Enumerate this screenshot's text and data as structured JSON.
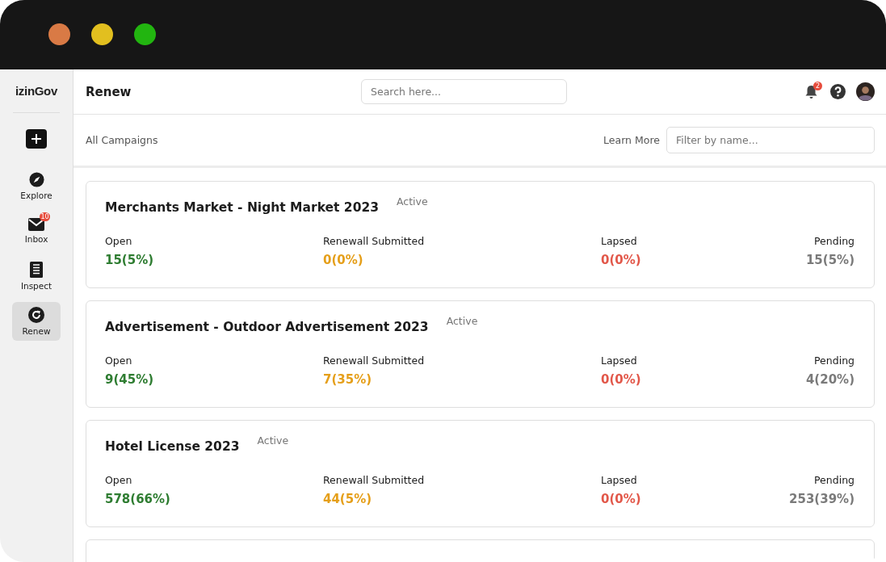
{
  "window_controls": [
    {
      "color": "#d97a45"
    },
    {
      "color": "#e2bf1f"
    },
    {
      "color": "#22b510"
    }
  ],
  "sidebar": {
    "logo": "izinGov",
    "items": [
      {
        "kind": "add",
        "selected": false
      },
      {
        "kind": "explore",
        "label": "Explore",
        "selected": false
      },
      {
        "kind": "inbox",
        "label": "Inbox",
        "badge": "10",
        "selected": false
      },
      {
        "kind": "inspect",
        "label": "Inspect",
        "selected": false
      },
      {
        "kind": "renew",
        "label": "Renew",
        "selected": true
      }
    ]
  },
  "header": {
    "title": "Renew",
    "search": {
      "placeholder": "Search here..."
    },
    "notifications_badge": "2"
  },
  "subheader": {
    "title": "All Campaigns",
    "learn_more": "Learn More",
    "filter": {
      "placeholder": "Filter by name..."
    }
  },
  "campaigns": [
    {
      "name": "Merchants Market - Night Market 2023",
      "status": "Active",
      "stats": [
        {
          "kind": "open",
          "label": "Open",
          "value": "15(5%)"
        },
        {
          "kind": "submitted",
          "label": "Renewall Submitted",
          "value": "0(0%)"
        },
        {
          "kind": "lapsed",
          "label": "Lapsed",
          "value": "0(0%)"
        },
        {
          "kind": "pending",
          "label": "Pending",
          "value": "15(5%)"
        }
      ]
    },
    {
      "name": "Advertisement - Outdoor Advertisement 2023",
      "status": "Active",
      "stats": [
        {
          "kind": "open",
          "label": "Open",
          "value": "9(45%)"
        },
        {
          "kind": "submitted",
          "label": "Renewall Submitted",
          "value": "7(35%)"
        },
        {
          "kind": "lapsed",
          "label": "Lapsed",
          "value": "0(0%)"
        },
        {
          "kind": "pending",
          "label": "Pending",
          "value": "4(20%)"
        }
      ]
    },
    {
      "name": "Hotel License 2023",
      "status": "Active",
      "stats": [
        {
          "kind": "open",
          "label": "Open",
          "value": "578(66%)"
        },
        {
          "kind": "submitted",
          "label": "Renewall Submitted",
          "value": "44(5%)"
        },
        {
          "kind": "lapsed",
          "label": "Lapsed",
          "value": "0(0%)"
        },
        {
          "kind": "pending",
          "label": "Pending",
          "value": "253(39%)"
        }
      ]
    }
  ]
}
